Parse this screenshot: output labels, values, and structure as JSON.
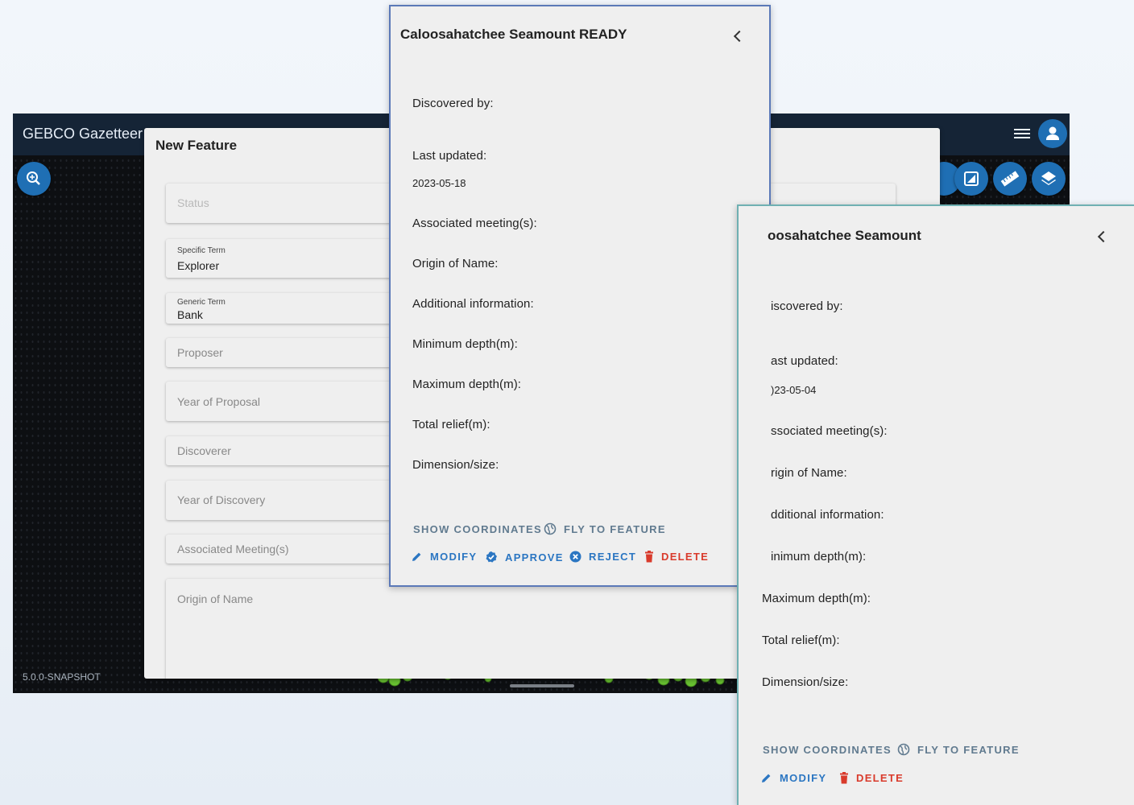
{
  "app": {
    "title": "GEBCO Gazetteer",
    "version": "5.0.0-SNAPSHOT"
  },
  "form": {
    "title": "New Feature",
    "fields": [
      {
        "label": "Status",
        "value": ""
      },
      {
        "label": "Specific Term",
        "value": "Explorer"
      },
      {
        "label": "Generic Term",
        "value": "Bank"
      },
      {
        "label": "Proposer",
        "value": ""
      },
      {
        "label": "Year of Proposal",
        "value": ""
      },
      {
        "label": "Discoverer",
        "value": ""
      },
      {
        "label": "Year of Discovery",
        "value": ""
      },
      {
        "label": "Associated Meeting(s)",
        "value": ""
      },
      {
        "label": "Origin of Name",
        "value": ""
      }
    ]
  },
  "panel_front": {
    "title": "Caloosahatchee Seamount READY",
    "labels": {
      "discovered_by": "Discovered by:",
      "last_updated": "Last updated:",
      "last_updated_value": "2023-05-18",
      "meetings": "Associated meeting(s):",
      "origin": "Origin of Name:",
      "additional": "Additional information:",
      "min_depth": "Minimum depth(m):",
      "max_depth": "Maximum depth(m):",
      "relief": "Total relief(m):",
      "dimension": "Dimension/size:"
    },
    "actions": {
      "show_coordinates": "SHOW COORDINATES",
      "fly_to_feature": "FLY TO FEATURE",
      "modify": "MODIFY",
      "approve": "APPROVE",
      "reject": "REJECT",
      "delete": "DELETE"
    }
  },
  "panel_back": {
    "title": "oosahatchee Seamount",
    "labels": {
      "discovered_by": "iscovered by:",
      "last_updated": "ast updated:",
      "last_updated_value": ")23-05-04",
      "meetings": "ssociated meeting(s):",
      "origin": "rigin of Name:",
      "additional": "dditional information:",
      "min_depth": "inimum depth(m):",
      "max_depth": "Maximum depth(m):",
      "relief": "Total relief(m):",
      "dimension": "Dimension/size:"
    },
    "actions": {
      "show_coordinates": "SHOW COORDINATES",
      "fly_to_feature": "FLY TO FEATURE",
      "modify": "MODIFY",
      "delete": "DELETE"
    }
  },
  "colors": {
    "primary": "#2b76c2",
    "danger": "#d93a2b",
    "topbar": "#152436",
    "map_marker": "#69c232"
  },
  "icons": [
    "search-icon",
    "menu-icon",
    "account-icon",
    "split-view-icon",
    "ruler-icon",
    "layers-icon",
    "globe-icon",
    "pencil-icon",
    "check-badge-icon",
    "cancel-circle-icon",
    "trash-icon",
    "chevron-left-icon"
  ]
}
